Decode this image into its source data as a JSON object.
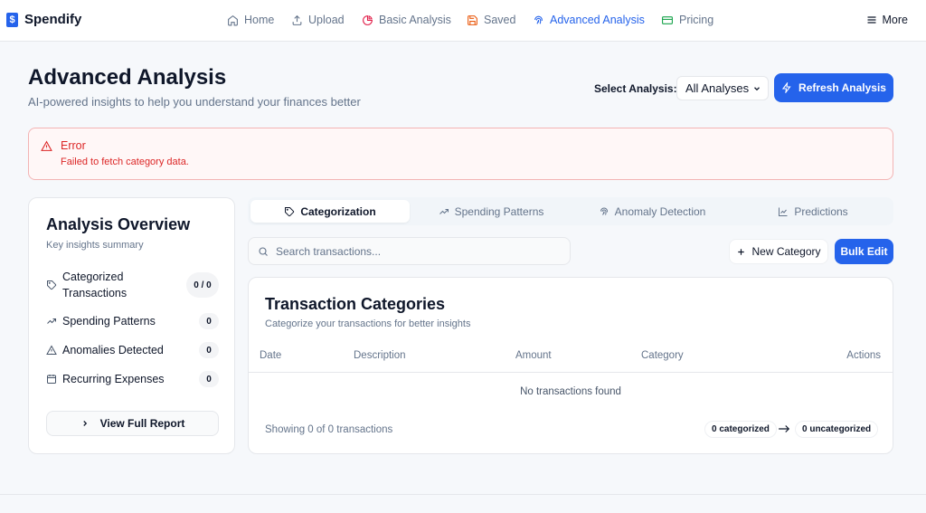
{
  "app": {
    "name": "Spendify",
    "logo_glyph": "$"
  },
  "nav": {
    "items": [
      {
        "label": "Home",
        "icon": "home-icon",
        "active": false
      },
      {
        "label": "Upload",
        "icon": "upload-icon",
        "active": false
      },
      {
        "label": "Basic Analysis",
        "icon": "pie-chart-icon",
        "active": false
      },
      {
        "label": "Saved",
        "icon": "save-icon",
        "active": false
      },
      {
        "label": "Advanced Analysis",
        "icon": "fingerprint-icon",
        "active": true
      },
      {
        "label": "Pricing",
        "icon": "credit-card-icon",
        "active": false
      }
    ],
    "more_label": "More"
  },
  "header": {
    "title": "Advanced Analysis",
    "subtitle": "AI-powered insights to help you understand your finances better",
    "select_label": "Select Analysis:",
    "select_value": "All Analyses",
    "refresh_label": "Refresh Analysis"
  },
  "error": {
    "title": "Error",
    "message": "Failed to fetch category data."
  },
  "overview": {
    "title": "Analysis Overview",
    "subtitle": "Key insights summary",
    "rows": [
      {
        "label": "Categorized Transactions",
        "count": "0 / 0",
        "icon": "tag-icon"
      },
      {
        "label": "Spending Patterns",
        "count": "0",
        "icon": "trending-up-icon"
      },
      {
        "label": "Anomalies Detected",
        "count": "0",
        "icon": "alert-triangle-icon"
      },
      {
        "label": "Recurring Expenses",
        "count": "0",
        "icon": "calendar-icon"
      }
    ],
    "report_label": "View Full Report"
  },
  "tabs": [
    {
      "label": "Categorization",
      "icon": "tag-icon",
      "active": true
    },
    {
      "label": "Spending Patterns",
      "icon": "trending-up-icon",
      "active": false
    },
    {
      "label": "Anomaly Detection",
      "icon": "fingerprint-icon",
      "active": false
    },
    {
      "label": "Predictions",
      "icon": "line-chart-icon",
      "active": false
    }
  ],
  "toolbar": {
    "search_placeholder": "Search transactions...",
    "new_category_label": "New Category",
    "bulk_edit_label": "Bulk Edit"
  },
  "transactions": {
    "title": "Transaction Categories",
    "subtitle": "Categorize your transactions for better insights",
    "columns": [
      "Date",
      "Description",
      "Amount",
      "Category",
      "Actions"
    ],
    "empty_text": "No transactions found",
    "footer_text": "Showing 0 of 0 transactions",
    "categorized_label": "0 categorized",
    "uncategorized_label": "0 uncategorized"
  },
  "colors": {
    "accent": "#2563eb",
    "error": "#dc2626",
    "text": "#0f172a",
    "muted": "#64748b"
  }
}
